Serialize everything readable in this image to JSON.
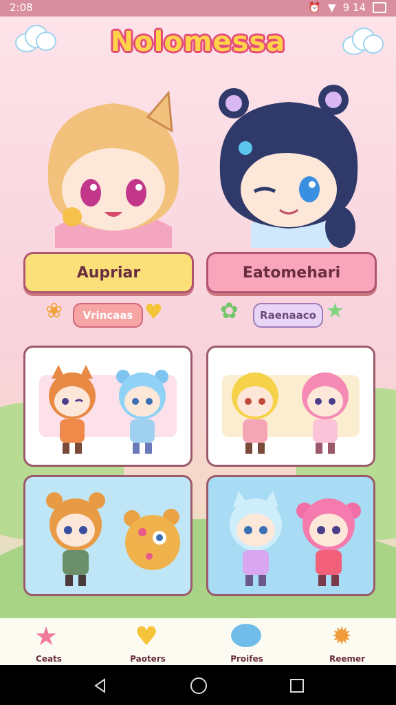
{
  "status": {
    "time": "2:08",
    "battery_text": "9 14",
    "icons": [
      "alarm-icon",
      "wifi-icon",
      "battery-icon"
    ]
  },
  "app": {
    "title": "Nolomessa"
  },
  "heroes": [
    {
      "name": "Aupriar",
      "tag": "Vrincaas",
      "button_color": "#fbe07a",
      "tag_color": "#f7a4a4"
    },
    {
      "name": "Eatomehari",
      "tag": "Raenaaco",
      "button_color": "#f9a6bc",
      "tag_color": "#e9d6f6"
    }
  ],
  "nav": {
    "items": [
      {
        "label": "Ceats",
        "icon": "star-icon"
      },
      {
        "label": "Paoters",
        "icon": "heart-face-icon"
      },
      {
        "label": "Proifes",
        "icon": "fish-icon"
      },
      {
        "label": "Reemer",
        "icon": "crab-icon"
      }
    ]
  },
  "system_nav": {
    "icons": [
      "back-icon",
      "home-icon",
      "recents-icon"
    ]
  },
  "colors": {
    "accent": "#e44d7a",
    "title_fill": "#ffd24a",
    "card_pink": "#fce8ee",
    "card_blue": "#bfe6f6"
  }
}
